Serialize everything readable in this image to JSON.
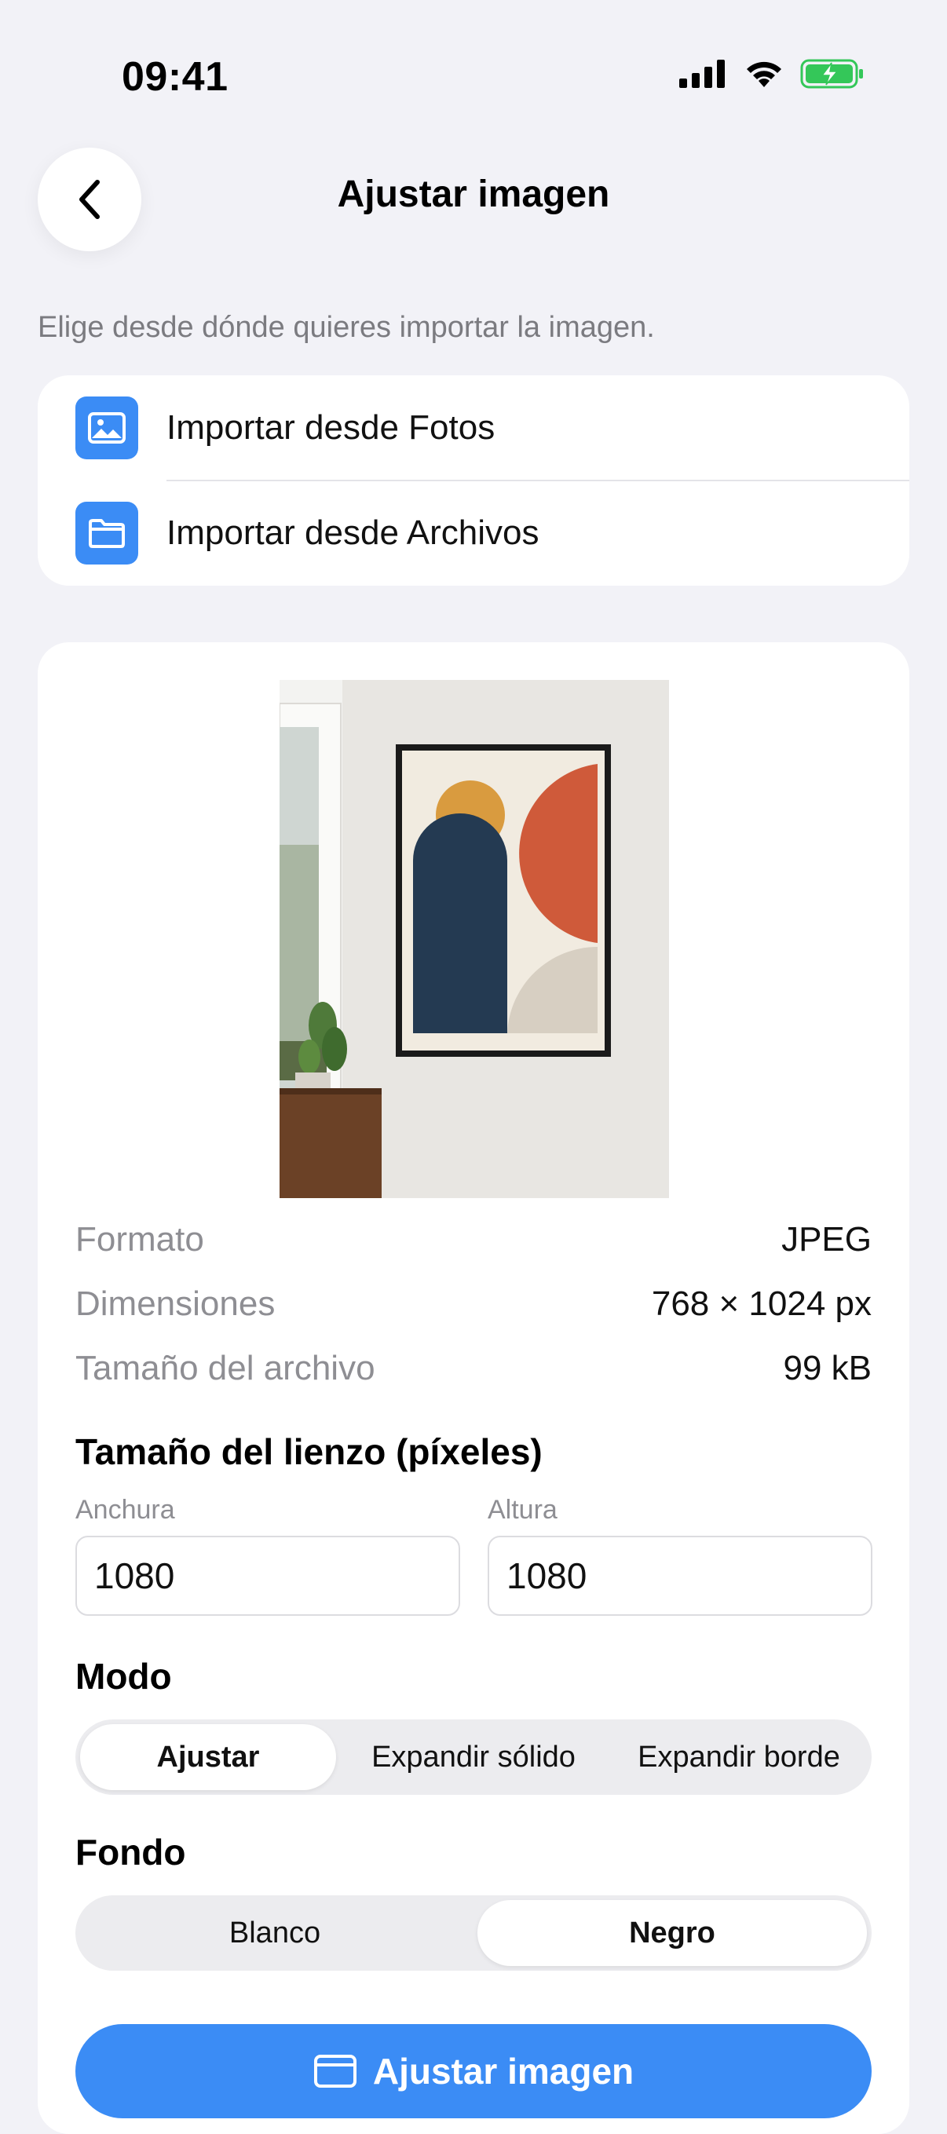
{
  "status": {
    "time": "09:41"
  },
  "nav": {
    "title": "Ajustar imagen"
  },
  "hint": "Elige desde dónde quieres importar la imagen.",
  "import": {
    "photos_label": "Importar desde Fotos",
    "files_label": "Importar desde Archivos"
  },
  "image_info": [
    {
      "key": "Formato",
      "value": "JPEG"
    },
    {
      "key": "Dimensiones",
      "value": "768 × 1024 px"
    },
    {
      "key": "Tamaño del archivo",
      "value": "99 kB"
    }
  ],
  "canvas": {
    "title": "Tamaño del lienzo (píxeles)",
    "width_label": "Anchura",
    "width_value": "1080",
    "height_label": "Altura",
    "height_value": "1080"
  },
  "mode": {
    "title": "Modo",
    "options": [
      "Ajustar",
      "Expandir sólido",
      "Expandir borde"
    ],
    "selected": "Ajustar"
  },
  "background": {
    "title": "Fondo",
    "options": [
      "Blanco",
      "Negro"
    ],
    "selected": "Negro"
  },
  "action": {
    "label": "Ajustar imagen"
  },
  "colors": {
    "accent": "#3b8cf5",
    "page_bg": "#f2f2f7",
    "battery": "#34c759"
  }
}
